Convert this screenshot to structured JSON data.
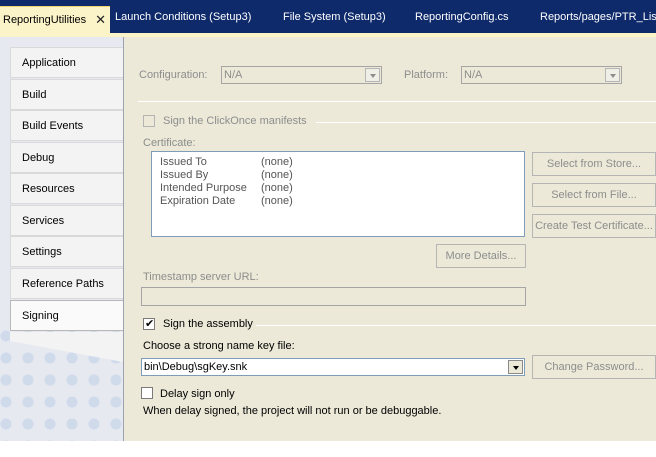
{
  "tabs": [
    {
      "label": "ReportingUtilities",
      "active": true
    },
    {
      "label": "Launch Conditions (Setup3)"
    },
    {
      "label": "File System (Setup3)"
    },
    {
      "label": "ReportingConfig.cs"
    },
    {
      "label": "Reports/pages/PTR_Lis"
    }
  ],
  "tab_close_icon": "close-icon",
  "nav": {
    "items": [
      "Application",
      "Build",
      "Build Events",
      "Debug",
      "Resources",
      "Services",
      "Settings",
      "Reference Paths",
      "Signing"
    ],
    "selected": "Signing"
  },
  "config": {
    "configuration_label": "Configuration:",
    "configuration_value": "N/A",
    "platform_label": "Platform:",
    "platform_value": "N/A"
  },
  "clickonce": {
    "checkbox_label": "Sign the ClickOnce manifests",
    "checked": false,
    "certificate_label": "Certificate:",
    "rows": [
      {
        "key": "Issued To",
        "value": "(none)"
      },
      {
        "key": "Issued By",
        "value": "(none)"
      },
      {
        "key": "Intended Purpose",
        "value": "(none)"
      },
      {
        "key": "Expiration Date",
        "value": "(none)"
      }
    ],
    "select_from_store": "Select from Store...",
    "select_from_file": "Select from File...",
    "create_test_certificate": "Create Test Certificate...",
    "more_details": "More Details...",
    "timestamp_label": "Timestamp server URL:",
    "timestamp_value": ""
  },
  "assembly": {
    "checkbox_label": "Sign the assembly",
    "checked": true,
    "key_file_label": "Choose a strong name key file:",
    "key_file_value": "bin\\Debug\\sgKey.snk",
    "change_password": "Change Password...",
    "delay_sign_label": "Delay sign only",
    "delay_sign_checked": false,
    "delay_note": "When delay signed, the project will not run or be debuggable."
  },
  "colors": {
    "tabstrip": "#0f2a6b",
    "active_tab": "#fbf4c8",
    "panel": "#ece9d8"
  }
}
